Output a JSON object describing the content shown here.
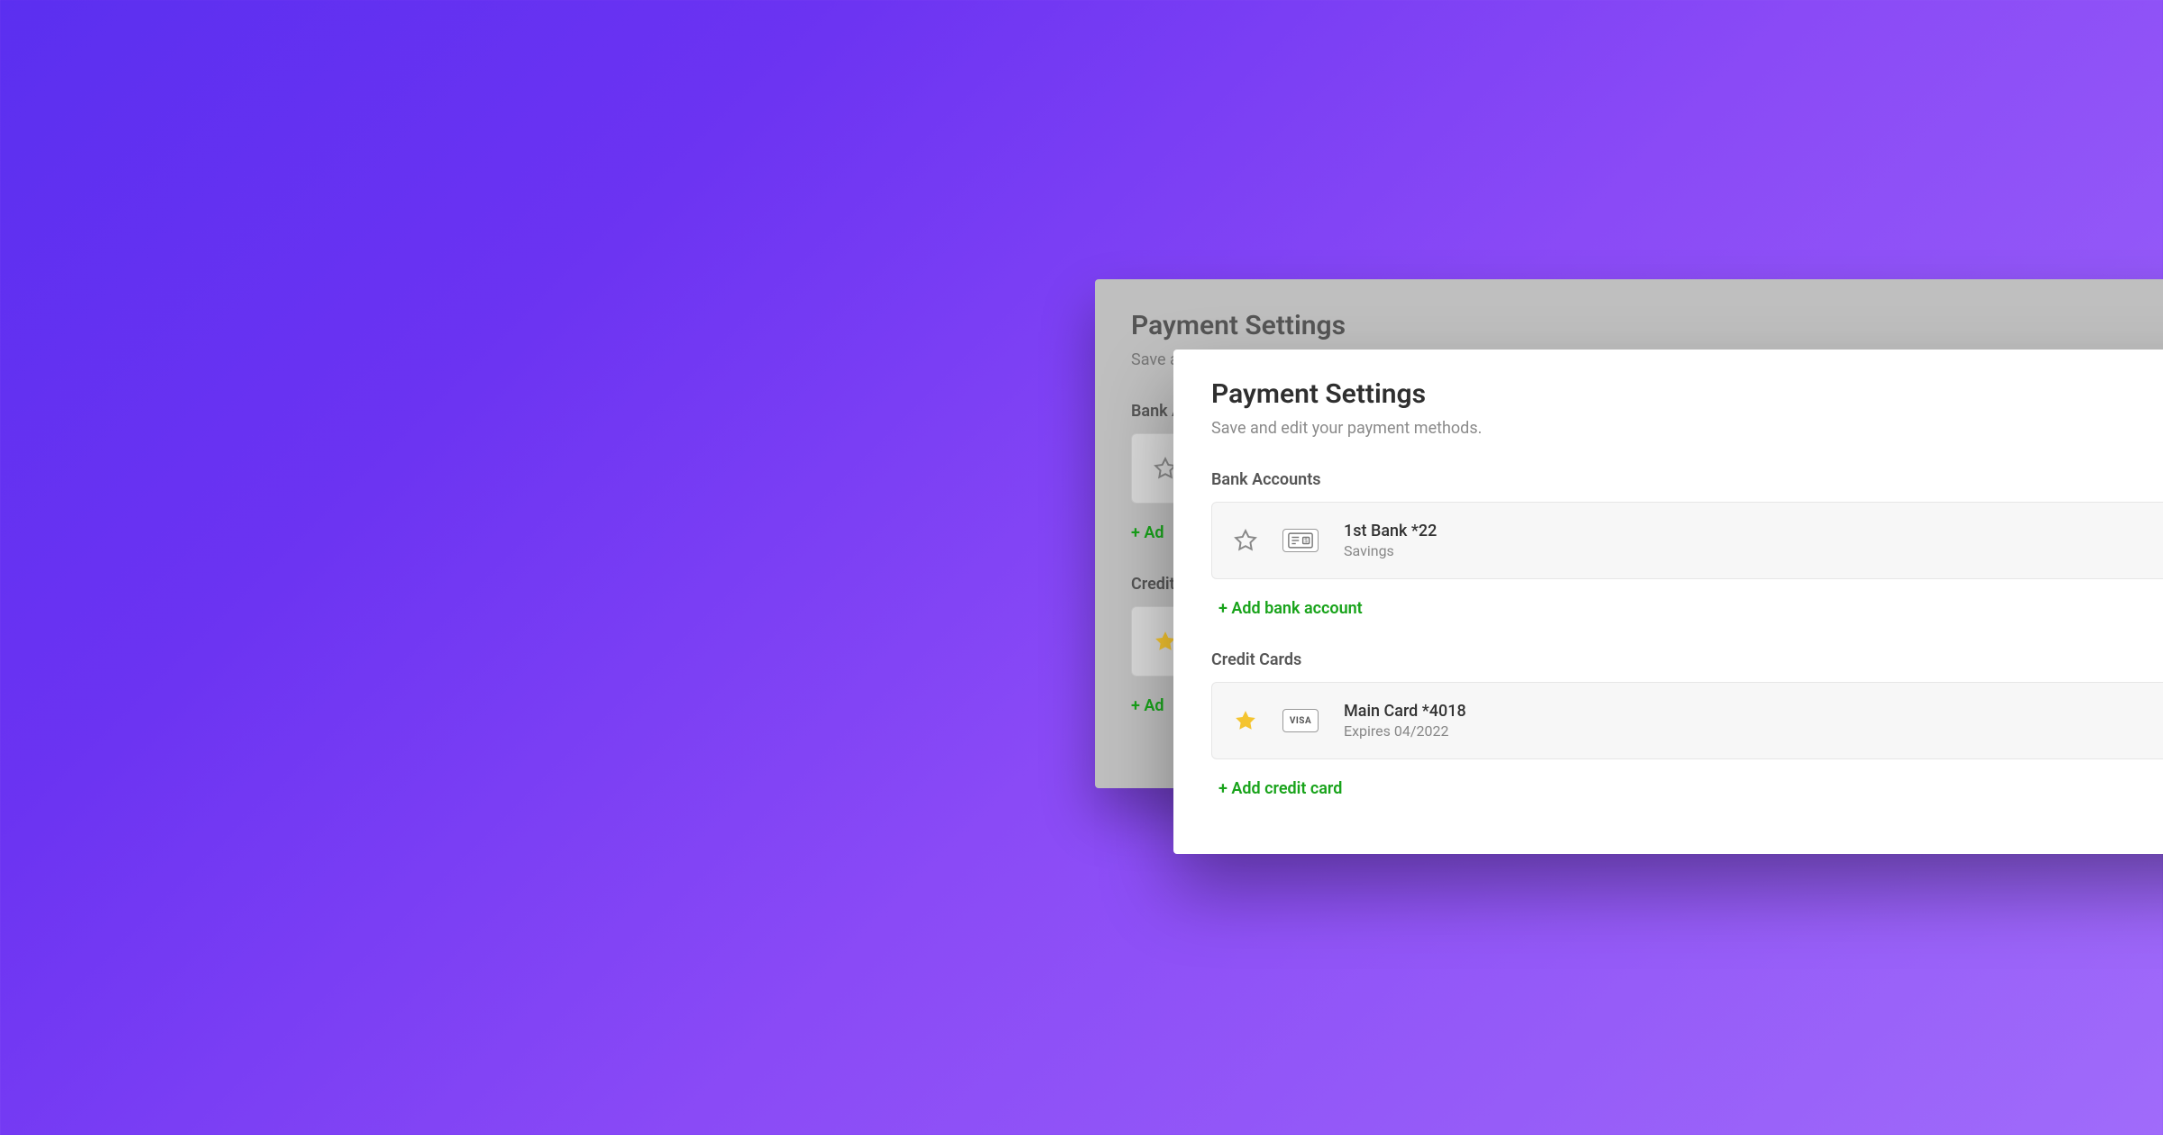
{
  "page": {
    "title": "Payment Settings",
    "subtitle": "Save and edit your payment methods."
  },
  "sections": {
    "bank": {
      "label": "Bank Accounts",
      "add_label": "+ Add bank account",
      "items": [
        {
          "title": "1st Bank *22",
          "meta": "Savings",
          "favorite": false
        }
      ]
    },
    "cards": {
      "label": "Credit Cards",
      "add_label": "+ Add credit card",
      "items": [
        {
          "title": "Main Card *4018",
          "meta": "Expires 04/2022",
          "brand": "VISA",
          "favorite": true
        }
      ]
    }
  },
  "back_card": {
    "title": "Payment Settings",
    "subtitle_prefix": "Save an",
    "bank_label_prefix": "Bank A",
    "credit_label_prefix": "Credit C",
    "add_prefix": "+ Ad"
  },
  "colors": {
    "accent_green": "#18a31a",
    "star_gold": "#f4c430"
  }
}
